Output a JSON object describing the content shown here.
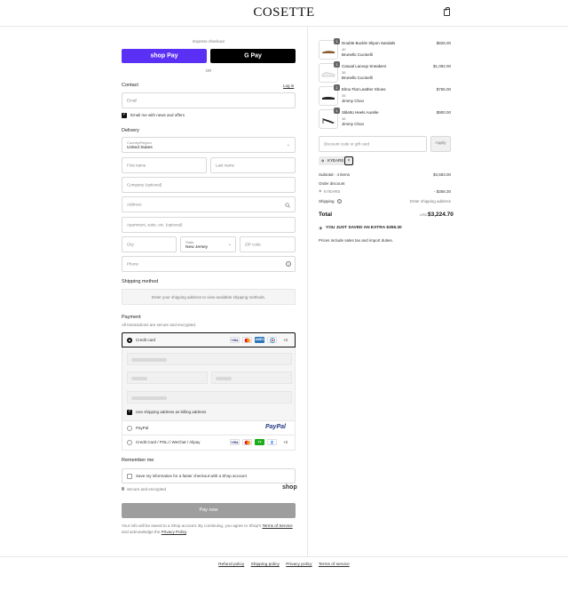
{
  "header": {
    "logo": "COSETTE",
    "bag_icon": "shopping-bag-icon"
  },
  "express": {
    "title": "Express checkout",
    "shop_label": "shop Pay",
    "gpay_label": "G Pay",
    "or": "OR"
  },
  "contact": {
    "title": "Contact",
    "login": "Log in",
    "email_placeholder": "Email",
    "newsletter": "Email me with news and offers"
  },
  "delivery": {
    "title": "Delivery",
    "country_label": "Country/Region",
    "country_value": "United States",
    "first_name": "First name",
    "last_name": "Last name",
    "company": "Company (optional)",
    "address": "Address",
    "apartment": "Apartment, suite, etc. (optional)",
    "city": "City",
    "state_label": "State",
    "state_value": "New Jersey",
    "zip": "ZIP code",
    "phone": "Phone"
  },
  "shipping_method": {
    "title": "Shipping method",
    "note": "Enter your shipping address to view available shipping methods."
  },
  "payment": {
    "title": "Payment",
    "subtitle": "All transactions are secure and encrypted.",
    "credit_card": "Credit card",
    "card_more": "+2",
    "billing_same": "Use shipping address as billing address",
    "paypal": "PayPal",
    "paypal_logo": "PayPal",
    "alt": "Credit Card / POLi / WeChat / Alipay",
    "alt_more": "+2"
  },
  "remember": {
    "title": "Remember me",
    "save_info": "Save my information for a faster checkout with a Shop account",
    "secure": "Secure and encrypted",
    "shop_logo": "shop"
  },
  "pay_now": "Pay now",
  "legal": {
    "text1": "Your info will be saved to a Shop account. By continuing, you agree to Shop's ",
    "terms": "Terms of Service",
    "text2": " and acknowledge the ",
    "privacy": "Privacy Policy",
    "text3": "."
  },
  "cart": {
    "items": [
      {
        "qty": "1",
        "name": "Double Buckle Slipon Sandals",
        "size": "40",
        "brand": "Brunello Cucinelli",
        "price": "$826.00"
      },
      {
        "qty": "1",
        "name": "Casual Laceup Sneakers",
        "size": "36",
        "brand": "Brunello Cucinelli",
        "price": "$1,092.00"
      },
      {
        "qty": "1",
        "name": "Elmo Flat Leather Shoes",
        "size": "35",
        "brand": "Jimmy Choo",
        "price": "$765.00"
      },
      {
        "qty": "1",
        "name": "Stiletto Heels Aurelie",
        "size": "36",
        "brand": "Jimmy Choo",
        "price": "$900.00"
      }
    ],
    "discount_placeholder": "Discount code or gift card",
    "apply": "Apply",
    "tag": "KYEARS",
    "subtotal_label": "Subtotal · 4 items",
    "subtotal": "$3,583.00",
    "order_discount": "Order discount",
    "code": "KYEARS",
    "discount": "- $358.30",
    "shipping_label": "Shipping",
    "shipping_value": "Enter shipping address",
    "total_label": "Total",
    "currency": "USD",
    "total": "$3,224.70",
    "saved": "YOU JUST SAVED AN EXTRA $358.30",
    "tax_note": "Prices include sales tax and import duties."
  },
  "footer": {
    "refund": "Refund policy",
    "shipping": "Shipping policy",
    "privacy": "Privacy policy",
    "terms": "Terms of service"
  }
}
